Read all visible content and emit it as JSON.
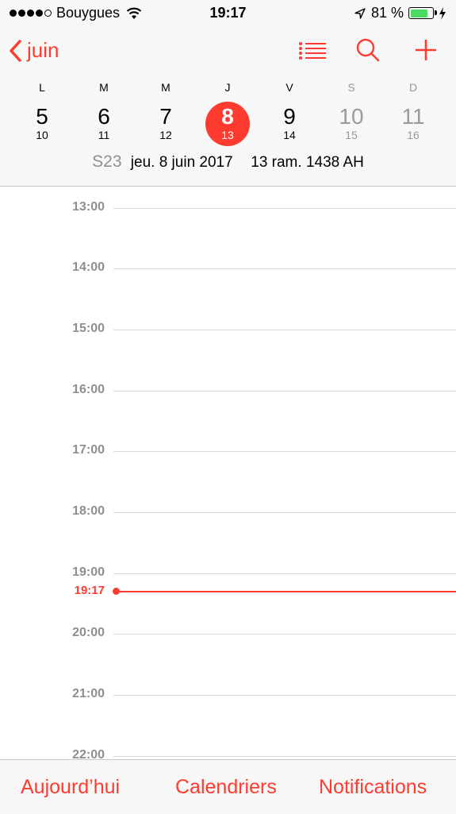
{
  "status_bar": {
    "carrier": "Bouygues",
    "time": "19:17",
    "battery": "81 %",
    "battery_level": 0.81,
    "signal_icons": [
      "signal-dots-icon",
      "wifi-icon",
      "location-arrow-icon",
      "battery-icon",
      "charging-bolt-icon"
    ]
  },
  "nav": {
    "back_label": "juin",
    "icons": [
      "list-icon",
      "search-icon",
      "add-icon"
    ]
  },
  "week": {
    "days": [
      {
        "letter": "L",
        "num": "5",
        "hijri": "10"
      },
      {
        "letter": "M",
        "num": "6",
        "hijri": "11"
      },
      {
        "letter": "M",
        "num": "7",
        "hijri": "12"
      },
      {
        "letter": "J",
        "num": "8",
        "hijri": "13"
      },
      {
        "letter": "V",
        "num": "9",
        "hijri": "14"
      },
      {
        "letter": "S",
        "num": "10",
        "hijri": "15"
      },
      {
        "letter": "D",
        "num": "11",
        "hijri": "16"
      }
    ],
    "selected_index": 3
  },
  "dateline": {
    "week": "S23",
    "date": "jeu. 8 juin 2017",
    "hijri": "13 ram. 1438 AH"
  },
  "hours": [
    "13:00",
    "14:00",
    "15:00",
    "16:00",
    "17:00",
    "18:00",
    "19:00",
    "20:00",
    "21:00",
    "22:00"
  ],
  "now": "19:17",
  "tabbar": {
    "today": "Aujourd’hui",
    "calendars": "Calendriers",
    "notifications": "Notifications"
  },
  "colors": {
    "accent": "#ff3b30",
    "battery": "#4cd964",
    "muted": "#8e8e93"
  }
}
